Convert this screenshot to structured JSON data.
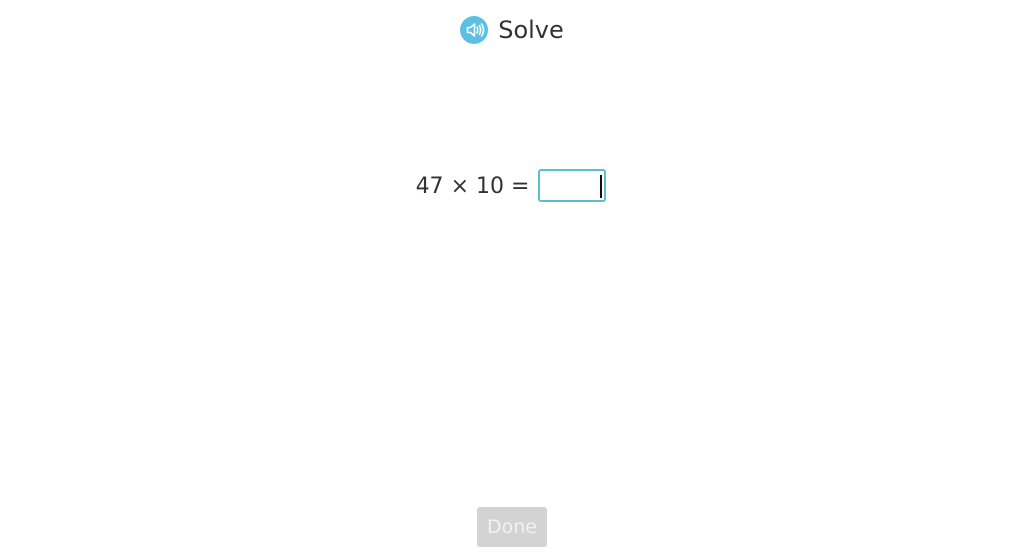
{
  "header": {
    "title": "Solve",
    "speaker_icon": "speaker-audio-icon",
    "accent_color": "#5bc0e4"
  },
  "problem": {
    "operand_a": "47",
    "operator": "×",
    "operand_b": "10",
    "equals": "=",
    "answer_value": "",
    "input_border_color": "#5fbcd3"
  },
  "footer": {
    "done_label": "Done",
    "done_enabled": false,
    "done_color": "#d3d3d3"
  }
}
